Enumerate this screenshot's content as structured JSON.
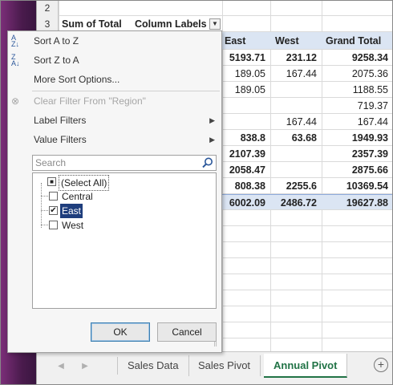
{
  "sheet": {
    "rows": [
      {
        "num": "2",
        "cells": []
      },
      {
        "num": "3",
        "cells": [
          "Sum of Total",
          "Column Labels"
        ]
      }
    ],
    "pivot": {
      "headers": [
        "East",
        "West",
        "Grand Total"
      ],
      "rows": [
        {
          "east": "5193.71",
          "west": "231.12",
          "total": "9258.34",
          "bold": true
        },
        {
          "east": "189.05",
          "west": "167.44",
          "total": "2075.36",
          "bold": false
        },
        {
          "east": "189.05",
          "west": "",
          "total": "1188.55",
          "bold": false
        },
        {
          "east": "",
          "west": "",
          "total": "719.37",
          "bold": false
        },
        {
          "east": "",
          "west": "167.44",
          "total": "167.44",
          "bold": false
        },
        {
          "east": "838.8",
          "west": "63.68",
          "total": "1949.93",
          "bold": true
        },
        {
          "east": "2107.39",
          "west": "",
          "total": "2357.39",
          "bold": true
        },
        {
          "east": "2058.47",
          "west": "",
          "total": "2875.66",
          "bold": true
        },
        {
          "east": "808.38",
          "west": "2255.6",
          "total": "10369.54",
          "bold": true
        }
      ],
      "grand_row": {
        "east": "6002.09",
        "west": "2486.72",
        "total": "19627.88"
      }
    }
  },
  "menu": {
    "sort_az": "Sort A to Z",
    "sort_za": "Sort Z to A",
    "more_sort": "More Sort Options...",
    "clear_filter": "Clear Filter From \"Region\"",
    "label_filters": "Label Filters",
    "value_filters": "Value Filters",
    "search_placeholder": "Search",
    "items": [
      {
        "label": "(Select All)",
        "state": "mixed"
      },
      {
        "label": "Central",
        "state": "unchecked"
      },
      {
        "label": "East",
        "state": "checked"
      },
      {
        "label": "West",
        "state": "unchecked"
      }
    ],
    "ok": "OK",
    "cancel": "Cancel"
  },
  "tabs": {
    "items": [
      "Sales Data",
      "Sales Pivot",
      "Annual Pivot"
    ],
    "active": "Annual Pivot"
  },
  "colors": {
    "excel_green": "#217346",
    "pivot_header": "#dbe5f3",
    "selection": "#1f3e7d"
  }
}
